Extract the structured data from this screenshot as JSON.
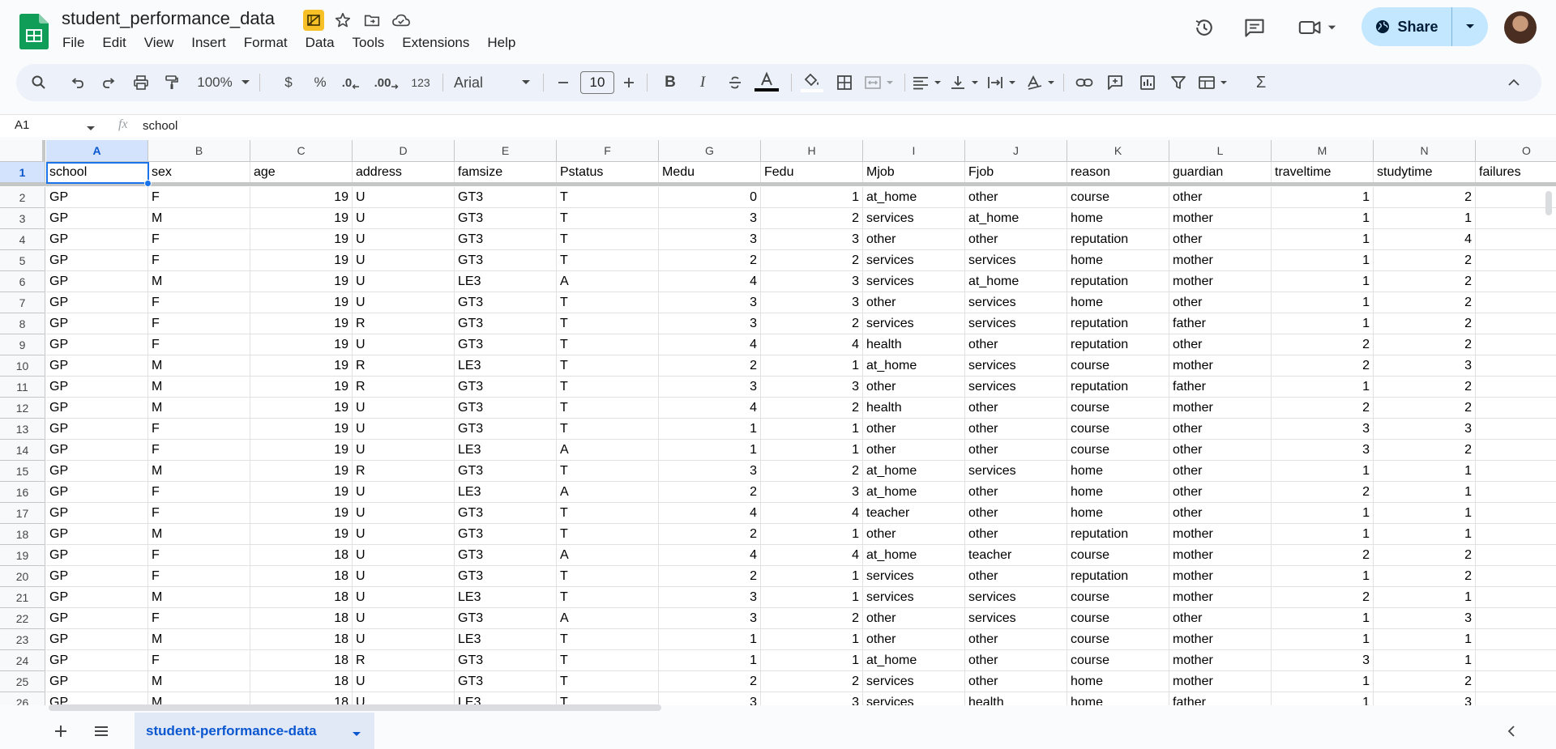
{
  "app": {
    "doc_title": "student_performance_data",
    "menus": [
      "File",
      "Edit",
      "View",
      "Insert",
      "Format",
      "Data",
      "Tools",
      "Extensions",
      "Help"
    ],
    "share_label": "Share"
  },
  "toolbar": {
    "zoom": "100%",
    "currency": "$",
    "percent": "%",
    "dec_decrease": ".0",
    "dec_increase": ".00",
    "number_format": "123",
    "font_family": "Arial",
    "font_size": "10",
    "bold": "B",
    "italic": "I",
    "sigma": "Σ"
  },
  "formula_bar": {
    "name_box": "A1",
    "fx": "fx",
    "value": "school"
  },
  "grid": {
    "columns": [
      "A",
      "B",
      "C",
      "D",
      "E",
      "F",
      "G",
      "H",
      "I",
      "J",
      "K",
      "L",
      "M",
      "N",
      "O"
    ],
    "rows": [
      {
        "n": "1",
        "c": [
          "school",
          "sex",
          "age",
          "address",
          "famsize",
          "Pstatus",
          "Medu",
          "Fedu",
          "Mjob",
          "Fjob",
          "reason",
          "guardian",
          "traveltime",
          "studytime",
          "failures"
        ]
      },
      {
        "n": "2",
        "c": [
          "GP",
          "F",
          "19",
          "U",
          "GT3",
          "T",
          "0",
          "1",
          "at_home",
          "other",
          "course",
          "other",
          "1",
          "2",
          ""
        ]
      },
      {
        "n": "3",
        "c": [
          "GP",
          "M",
          "19",
          "U",
          "GT3",
          "T",
          "3",
          "2",
          "services",
          "at_home",
          "home",
          "mother",
          "1",
          "1",
          ""
        ]
      },
      {
        "n": "4",
        "c": [
          "GP",
          "F",
          "19",
          "U",
          "GT3",
          "T",
          "3",
          "3",
          "other",
          "other",
          "reputation",
          "other",
          "1",
          "4",
          ""
        ]
      },
      {
        "n": "5",
        "c": [
          "GP",
          "F",
          "19",
          "U",
          "GT3",
          "T",
          "2",
          "2",
          "services",
          "services",
          "home",
          "mother",
          "1",
          "2",
          ""
        ]
      },
      {
        "n": "6",
        "c": [
          "GP",
          "M",
          "19",
          "U",
          "LE3",
          "A",
          "4",
          "3",
          "services",
          "at_home",
          "reputation",
          "mother",
          "1",
          "2",
          ""
        ]
      },
      {
        "n": "7",
        "c": [
          "GP",
          "F",
          "19",
          "U",
          "GT3",
          "T",
          "3",
          "3",
          "other",
          "services",
          "home",
          "other",
          "1",
          "2",
          ""
        ]
      },
      {
        "n": "8",
        "c": [
          "GP",
          "F",
          "19",
          "R",
          "GT3",
          "T",
          "3",
          "2",
          "services",
          "services",
          "reputation",
          "father",
          "1",
          "2",
          ""
        ]
      },
      {
        "n": "9",
        "c": [
          "GP",
          "F",
          "19",
          "U",
          "GT3",
          "T",
          "4",
          "4",
          "health",
          "other",
          "reputation",
          "other",
          "2",
          "2",
          ""
        ]
      },
      {
        "n": "10",
        "c": [
          "GP",
          "M",
          "19",
          "R",
          "LE3",
          "T",
          "2",
          "1",
          "at_home",
          "services",
          "course",
          "mother",
          "2",
          "3",
          ""
        ]
      },
      {
        "n": "11",
        "c": [
          "GP",
          "M",
          "19",
          "R",
          "GT3",
          "T",
          "3",
          "3",
          "other",
          "services",
          "reputation",
          "father",
          "1",
          "2",
          ""
        ]
      },
      {
        "n": "12",
        "c": [
          "GP",
          "M",
          "19",
          "U",
          "GT3",
          "T",
          "4",
          "2",
          "health",
          "other",
          "course",
          "mother",
          "2",
          "2",
          ""
        ]
      },
      {
        "n": "13",
        "c": [
          "GP",
          "F",
          "19",
          "U",
          "GT3",
          "T",
          "1",
          "1",
          "other",
          "other",
          "course",
          "other",
          "3",
          "3",
          ""
        ]
      },
      {
        "n": "14",
        "c": [
          "GP",
          "F",
          "19",
          "U",
          "LE3",
          "A",
          "1",
          "1",
          "other",
          "other",
          "course",
          "other",
          "3",
          "2",
          ""
        ]
      },
      {
        "n": "15",
        "c": [
          "GP",
          "M",
          "19",
          "R",
          "GT3",
          "T",
          "3",
          "2",
          "at_home",
          "services",
          "home",
          "other",
          "1",
          "1",
          ""
        ]
      },
      {
        "n": "16",
        "c": [
          "GP",
          "F",
          "19",
          "U",
          "LE3",
          "A",
          "2",
          "3",
          "at_home",
          "other",
          "home",
          "other",
          "2",
          "1",
          ""
        ]
      },
      {
        "n": "17",
        "c": [
          "GP",
          "F",
          "19",
          "U",
          "GT3",
          "T",
          "4",
          "4",
          "teacher",
          "other",
          "home",
          "other",
          "1",
          "1",
          ""
        ]
      },
      {
        "n": "18",
        "c": [
          "GP",
          "M",
          "19",
          "U",
          "GT3",
          "T",
          "2",
          "1",
          "other",
          "other",
          "reputation",
          "mother",
          "1",
          "1",
          ""
        ]
      },
      {
        "n": "19",
        "c": [
          "GP",
          "F",
          "18",
          "U",
          "GT3",
          "A",
          "4",
          "4",
          "at_home",
          "teacher",
          "course",
          "mother",
          "2",
          "2",
          ""
        ]
      },
      {
        "n": "20",
        "c": [
          "GP",
          "F",
          "18",
          "U",
          "GT3",
          "T",
          "2",
          "1",
          "services",
          "other",
          "reputation",
          "mother",
          "1",
          "2",
          ""
        ]
      },
      {
        "n": "21",
        "c": [
          "GP",
          "M",
          "18",
          "U",
          "LE3",
          "T",
          "3",
          "1",
          "services",
          "services",
          "course",
          "mother",
          "2",
          "1",
          ""
        ]
      },
      {
        "n": "22",
        "c": [
          "GP",
          "F",
          "18",
          "U",
          "GT3",
          "A",
          "3",
          "2",
          "other",
          "services",
          "course",
          "other",
          "1",
          "3",
          ""
        ]
      },
      {
        "n": "23",
        "c": [
          "GP",
          "M",
          "18",
          "U",
          "LE3",
          "T",
          "1",
          "1",
          "other",
          "other",
          "course",
          "mother",
          "1",
          "1",
          ""
        ]
      },
      {
        "n": "24",
        "c": [
          "GP",
          "F",
          "18",
          "R",
          "GT3",
          "T",
          "1",
          "1",
          "at_home",
          "other",
          "course",
          "mother",
          "3",
          "1",
          ""
        ]
      },
      {
        "n": "25",
        "c": [
          "GP",
          "M",
          "18",
          "U",
          "GT3",
          "T",
          "2",
          "2",
          "services",
          "other",
          "home",
          "mother",
          "1",
          "2",
          ""
        ]
      },
      {
        "n": "26",
        "c": [
          "GP",
          "M",
          "18",
          "U",
          "LE3",
          "T",
          "3",
          "3",
          "services",
          "health",
          "home",
          "father",
          "1",
          "3",
          ""
        ]
      }
    ]
  },
  "sheets": {
    "active": "student-performance-data"
  },
  "colors": {
    "selection": "#1a73e8",
    "share_bg": "#c2e7ff",
    "tab_active_text": "#0b57d0"
  }
}
